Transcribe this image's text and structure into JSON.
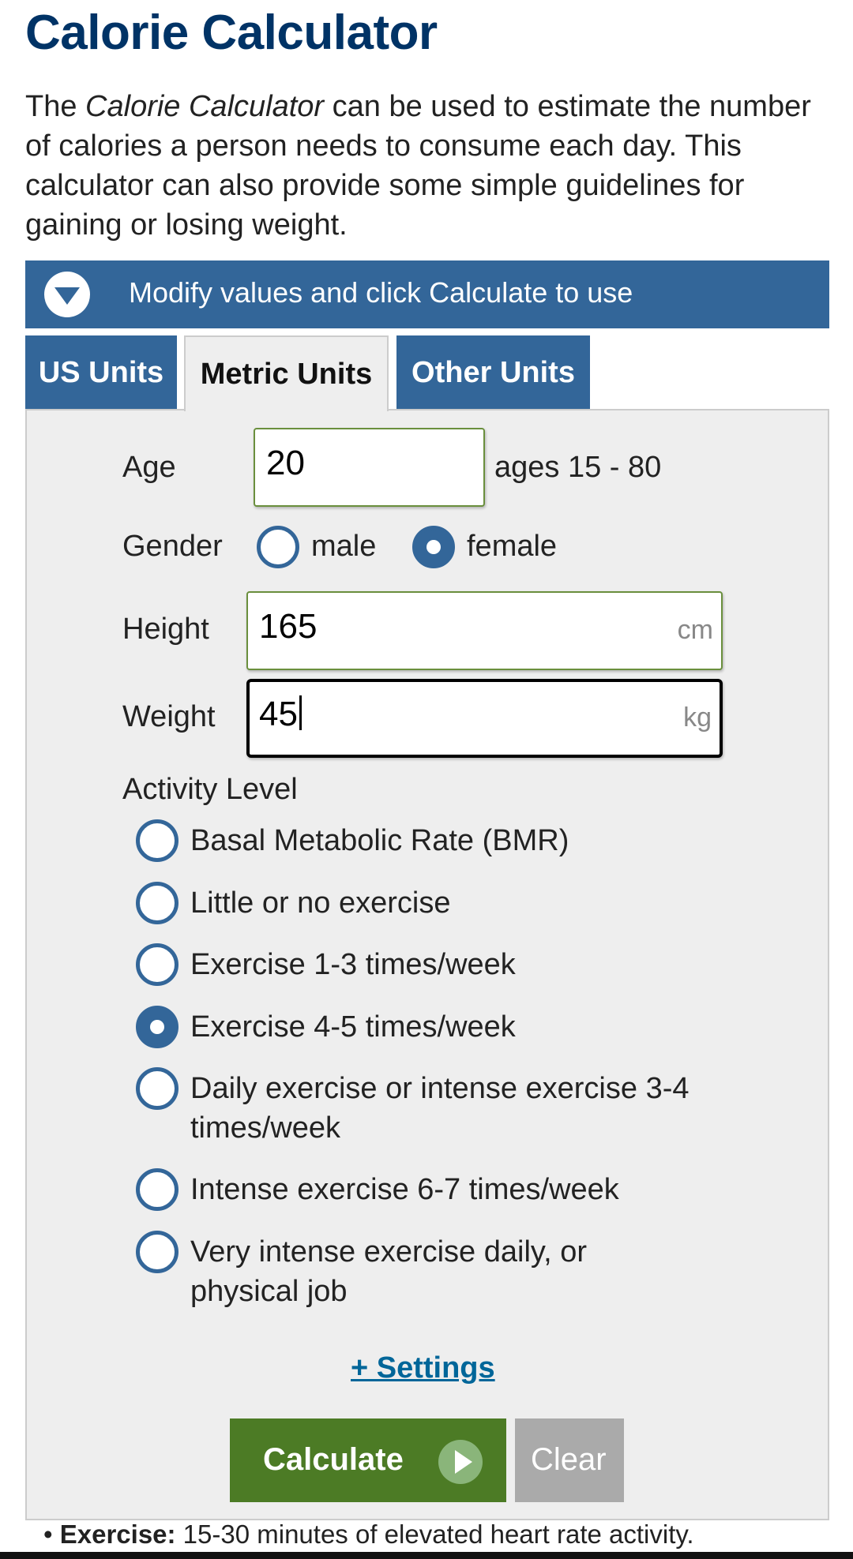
{
  "page": {
    "title": "Calorie Calculator",
    "intro_prefix": "The ",
    "intro_emphasis": "Calorie Calculator",
    "intro_suffix": " can be used to estimate the number of calories a person needs to consume each day. This calculator can also provide some simple guidelines for gaining or losing weight."
  },
  "banner": {
    "icon": "chevron-down-circle-icon",
    "text": "Modify values and click Calculate to use"
  },
  "tabs": [
    {
      "label": "US Units",
      "active": false
    },
    {
      "label": "Metric Units",
      "active": true
    },
    {
      "label": "Other Units",
      "active": false
    }
  ],
  "form": {
    "age": {
      "label": "Age",
      "value": "20",
      "hint": "ages 15 - 80"
    },
    "gender": {
      "label": "Gender",
      "options": [
        "male",
        "female"
      ],
      "selected": "female"
    },
    "height": {
      "label": "Height",
      "value": "165",
      "unit": "cm"
    },
    "weight": {
      "label": "Weight",
      "value": "45",
      "unit": "kg"
    },
    "activity": {
      "label": "Activity Level",
      "options": [
        "Basal Metabolic Rate (BMR)",
        "Little or no exercise",
        "Exercise 1-3 times/week",
        "Exercise 4-5 times/week",
        "Daily exercise or intense exercise 3-4 times/week",
        "Intense exercise 6-7 times/week",
        "Very intense exercise daily, or physical job"
      ],
      "selected_index": 3
    }
  },
  "settings_link": "+ Settings",
  "buttons": {
    "calculate": "Calculate",
    "clear": "Clear"
  },
  "footnote": {
    "term": "Exercise:",
    "text": " 15-30 minutes of elevated heart rate activity."
  },
  "colors": {
    "brand_blue": "#336699",
    "title_navy": "#003366",
    "calculate_green": "#4c7b25",
    "link": "#006699"
  }
}
